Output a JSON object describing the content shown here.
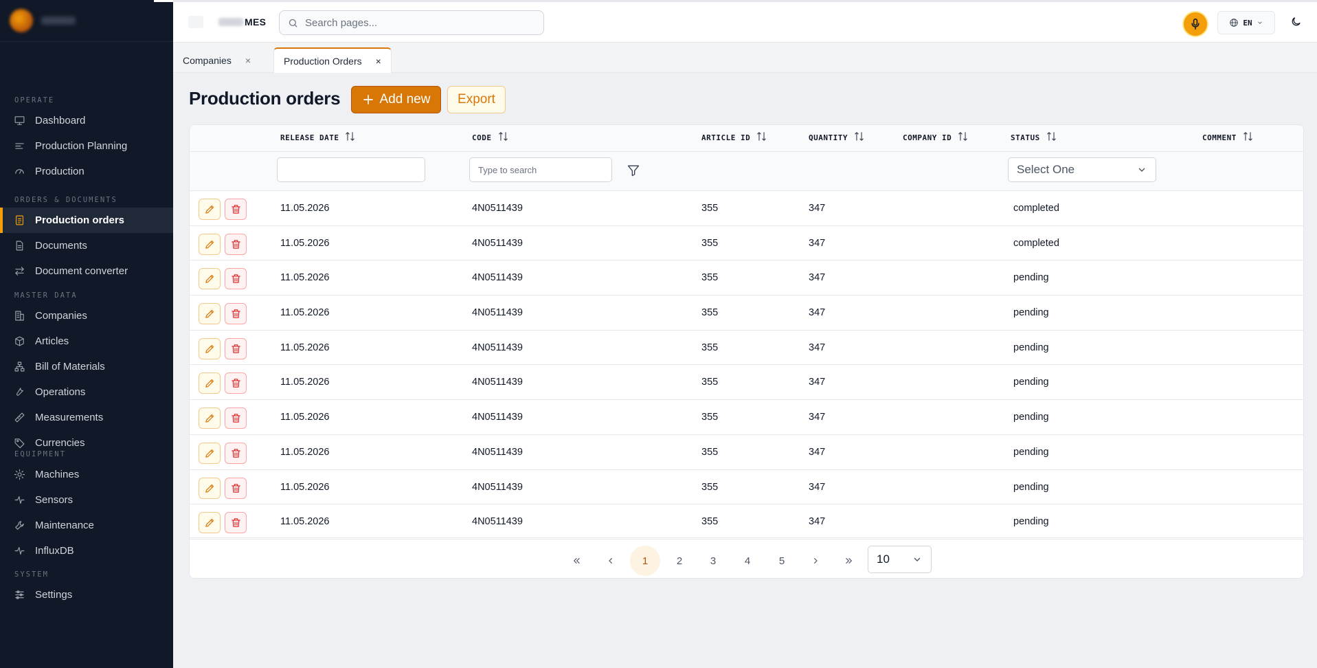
{
  "app": {
    "name_suffix": "MES"
  },
  "search": {
    "placeholder": "Search pages..."
  },
  "topbar": {
    "language": "EN"
  },
  "sidebar": {
    "sections": [
      {
        "label": "OPERATE",
        "items": [
          {
            "label": "Dashboard",
            "icon": "monitor-icon"
          },
          {
            "label": "Production Planning",
            "icon": "list-icon"
          },
          {
            "label": "Production",
            "icon": "gauge-icon"
          }
        ]
      },
      {
        "label": "ORDERS & DOCUMENTS",
        "items": [
          {
            "label": "Production orders",
            "icon": "clipboard-icon",
            "active": true
          },
          {
            "label": "Documents",
            "icon": "document-icon"
          },
          {
            "label": "Document converter",
            "icon": "convert-icon"
          }
        ]
      },
      {
        "label": "MASTER DATA",
        "items": [
          {
            "label": "Companies",
            "icon": "building-icon"
          },
          {
            "label": "Articles",
            "icon": "box-icon"
          },
          {
            "label": "Bill of Materials",
            "icon": "hierarchy-icon"
          },
          {
            "label": "Operations",
            "icon": "tool-icon"
          },
          {
            "label": "Measurements",
            "icon": "ruler-icon"
          },
          {
            "label": "Currencies",
            "icon": "tag-icon"
          }
        ]
      },
      {
        "label": "EQUIPMENT",
        "items": [
          {
            "label": "Machines",
            "icon": "cog-icon"
          },
          {
            "label": "Sensors",
            "icon": "pulse-icon"
          },
          {
            "label": "Maintenance",
            "icon": "wrench-icon"
          },
          {
            "label": "InfluxDB",
            "icon": "pulse-icon"
          }
        ]
      },
      {
        "label": "SYSTEM",
        "items": [
          {
            "label": "Settings",
            "icon": "sliders-icon"
          }
        ]
      }
    ]
  },
  "tabs": [
    {
      "label": "Companies",
      "close": "×"
    },
    {
      "label": "Production Orders",
      "close": "×",
      "active": true
    }
  ],
  "main": {
    "title": "Production orders",
    "add_label": "Add new",
    "export_label": "Export"
  },
  "table": {
    "columns": [
      "RELEASE DATE",
      "CODE",
      "ARTICLE ID",
      "QUANTITY",
      "COMPANY ID",
      "STATUS",
      "COMMENT"
    ],
    "filters": {
      "code_placeholder": "Type to search",
      "status_select": "Select One"
    },
    "rows": [
      {
        "release_date": "11.05.2026",
        "code": "4N0511439",
        "article_id": "355",
        "quantity": "347",
        "company_id": "",
        "status": "completed",
        "comment": ""
      },
      {
        "release_date": "11.05.2026",
        "code": "4N0511439",
        "article_id": "355",
        "quantity": "347",
        "company_id": "",
        "status": "completed",
        "comment": ""
      },
      {
        "release_date": "11.05.2026",
        "code": "4N0511439",
        "article_id": "355",
        "quantity": "347",
        "company_id": "",
        "status": "pending",
        "comment": ""
      },
      {
        "release_date": "11.05.2026",
        "code": "4N0511439",
        "article_id": "355",
        "quantity": "347",
        "company_id": "",
        "status": "pending",
        "comment": ""
      },
      {
        "release_date": "11.05.2026",
        "code": "4N0511439",
        "article_id": "355",
        "quantity": "347",
        "company_id": "",
        "status": "pending",
        "comment": ""
      },
      {
        "release_date": "11.05.2026",
        "code": "4N0511439",
        "article_id": "355",
        "quantity": "347",
        "company_id": "",
        "status": "pending",
        "comment": ""
      },
      {
        "release_date": "11.05.2026",
        "code": "4N0511439",
        "article_id": "355",
        "quantity": "347",
        "company_id": "",
        "status": "pending",
        "comment": ""
      },
      {
        "release_date": "11.05.2026",
        "code": "4N0511439",
        "article_id": "355",
        "quantity": "347",
        "company_id": "",
        "status": "pending",
        "comment": ""
      },
      {
        "release_date": "11.05.2026",
        "code": "4N0511439",
        "article_id": "355",
        "quantity": "347",
        "company_id": "",
        "status": "pending",
        "comment": ""
      },
      {
        "release_date": "11.05.2026",
        "code": "4N0511439",
        "article_id": "355",
        "quantity": "347",
        "company_id": "",
        "status": "pending",
        "comment": ""
      }
    ]
  },
  "pagination": {
    "pages": [
      "1",
      "2",
      "3",
      "4",
      "5"
    ],
    "current": "1",
    "per_page": "10"
  },
  "colors": {
    "accent": "#d97706",
    "sidebar_bg": "#111827",
    "danger": "#dc2626"
  }
}
